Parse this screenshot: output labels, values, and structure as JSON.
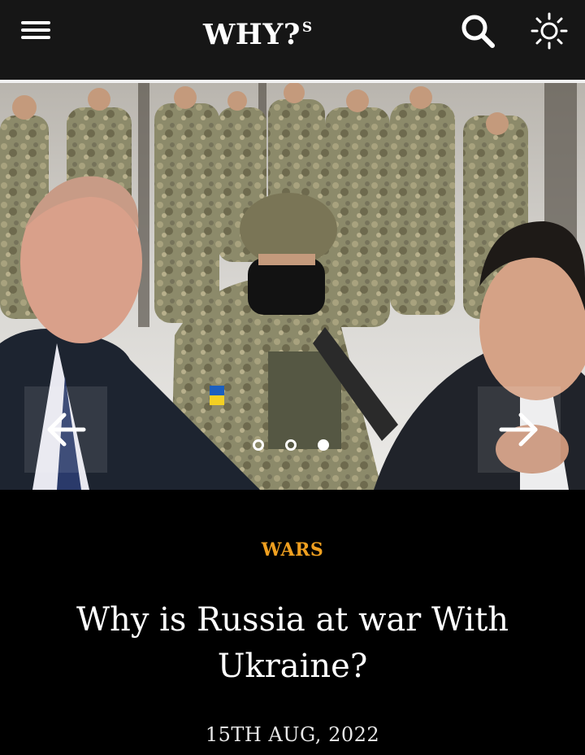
{
  "header": {
    "logo_text": "WHY?",
    "logo_superscript": "S",
    "menu_icon": "hamburger-menu-icon",
    "search_icon": "search-icon",
    "theme_icon": "sun-icon",
    "background": "#161616"
  },
  "hero": {
    "image_description_icon": "article-hero-image",
    "prev_icon": "arrow-left-icon",
    "next_icon": "arrow-right-icon",
    "slides_total": 3,
    "active_slide": 3
  },
  "article": {
    "category": "WARS",
    "category_color": "#f0a020",
    "title": "Why is Russia at war With Ukraine?",
    "date": "15TH AUG, 2022"
  }
}
